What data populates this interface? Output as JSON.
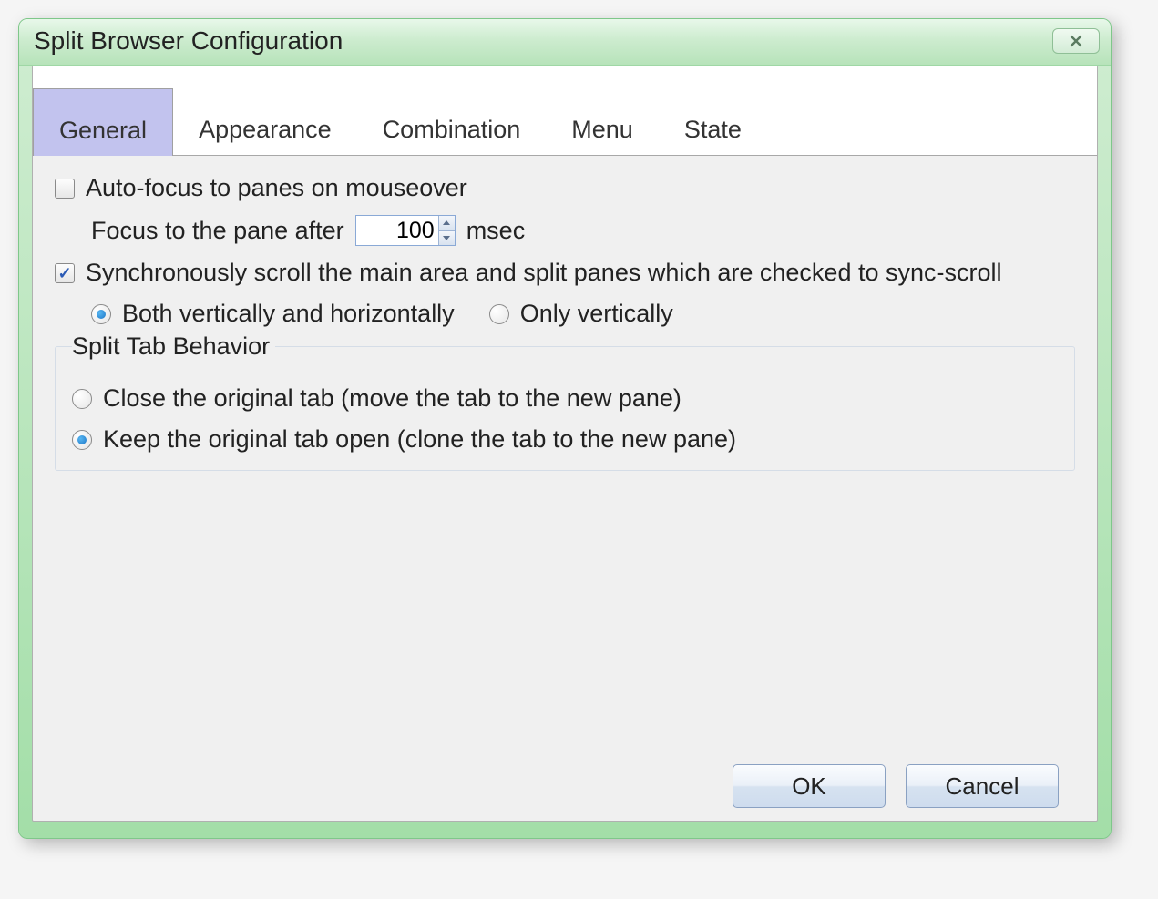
{
  "window": {
    "title": "Split Browser Configuration"
  },
  "tabs": {
    "items": [
      {
        "label": "General"
      },
      {
        "label": "Appearance"
      },
      {
        "label": "Combination"
      },
      {
        "label": "Menu"
      },
      {
        "label": "State"
      }
    ],
    "active_index": 0
  },
  "general": {
    "autofocus_label": "Auto-focus to panes on mouseover",
    "autofocus_checked": false,
    "focus_delay_label_before": "Focus to the pane after",
    "focus_delay_value": "100",
    "focus_delay_label_after": "msec",
    "sync_scroll_label": "Synchronously scroll the main area and split panes which are checked to sync-scroll",
    "sync_scroll_checked": true,
    "scroll_both_label": "Both vertically and horizontally",
    "scroll_vertical_label": "Only vertically",
    "scroll_selected": "both",
    "split_group_legend": "Split Tab Behavior",
    "split_close_label": "Close the original tab (move the tab to the new pane)",
    "split_keep_label": "Keep the original tab open (clone the tab to the new pane)",
    "split_selected": "keep"
  },
  "buttons": {
    "ok": "OK",
    "cancel": "Cancel"
  }
}
